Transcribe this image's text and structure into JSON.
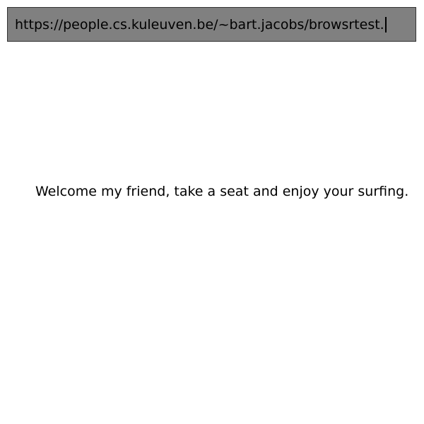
{
  "address_bar": {
    "url": "https://people.cs.kuleuven.be/~bart.jacobs/browsrtest."
  },
  "page": {
    "welcome_text": "Welcome my friend, take a seat and enjoy your surfing."
  },
  "colors": {
    "address_bar_background": "#808080",
    "page_background": "#ffffff",
    "text": "#000000"
  }
}
